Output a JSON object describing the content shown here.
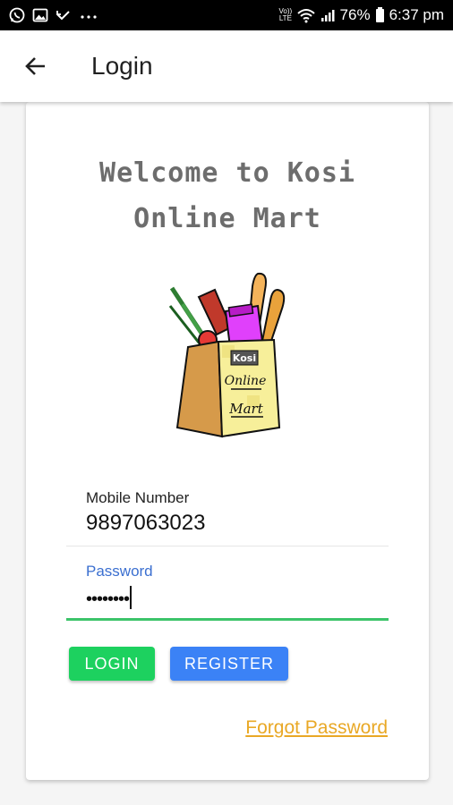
{
  "status_bar": {
    "battery": "76%",
    "time": "6:37 pm",
    "carrier": "Vo)) LTE",
    "left_icons": [
      "whatsapp-icon",
      "gallery-icon",
      "missed-call-icon",
      "more-icon"
    ],
    "right_icons": [
      "wifi-icon",
      "signal-icon",
      "battery-icon"
    ]
  },
  "app_bar": {
    "title": "Login",
    "back_icon": "arrow-left-icon"
  },
  "card": {
    "welcome_line1": "Welcome to Kosi",
    "welcome_line2": "Online Mart",
    "logo": {
      "line1": "Kosi",
      "line2": "Online",
      "line3": "Mart"
    }
  },
  "form": {
    "mobile": {
      "label": "Mobile Number",
      "value": "9897063023"
    },
    "password": {
      "label": "Password",
      "value": "••••••••"
    }
  },
  "buttons": {
    "login": "LOGIN",
    "register": "REGISTER"
  },
  "forgot_password": "Forgot Password",
  "colors": {
    "login_button": "#1dd15f",
    "register_button": "#3b82f6",
    "password_underline": "#3cc46a",
    "password_label": "#3b6fd0",
    "forgot_link": "#e9a825",
    "welcome_text": "#6d6d6d"
  }
}
